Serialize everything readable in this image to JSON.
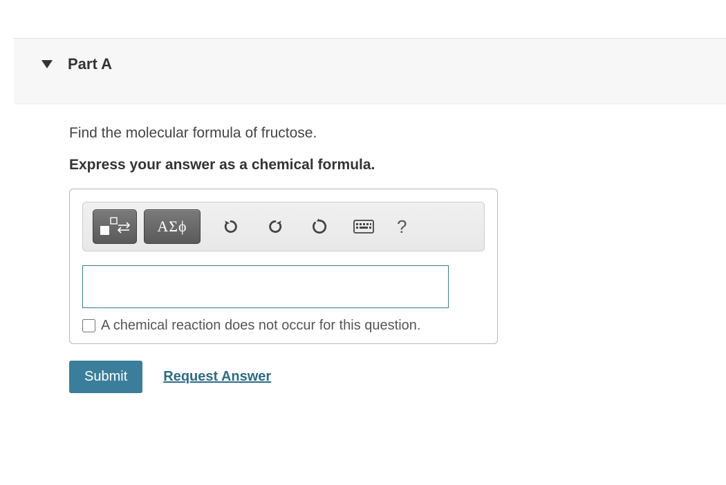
{
  "part": {
    "title": "Part A",
    "prompt": "Find the molecular formula of fructose.",
    "instruction": "Express your answer as a chemical formula."
  },
  "toolbar": {
    "greek_label": "ΑΣϕ",
    "help_label": "?"
  },
  "answer": {
    "value": "",
    "checkbox_label": "A chemical reaction does not occur for this question."
  },
  "actions": {
    "submit_label": "Submit",
    "request_label": "Request Answer"
  }
}
